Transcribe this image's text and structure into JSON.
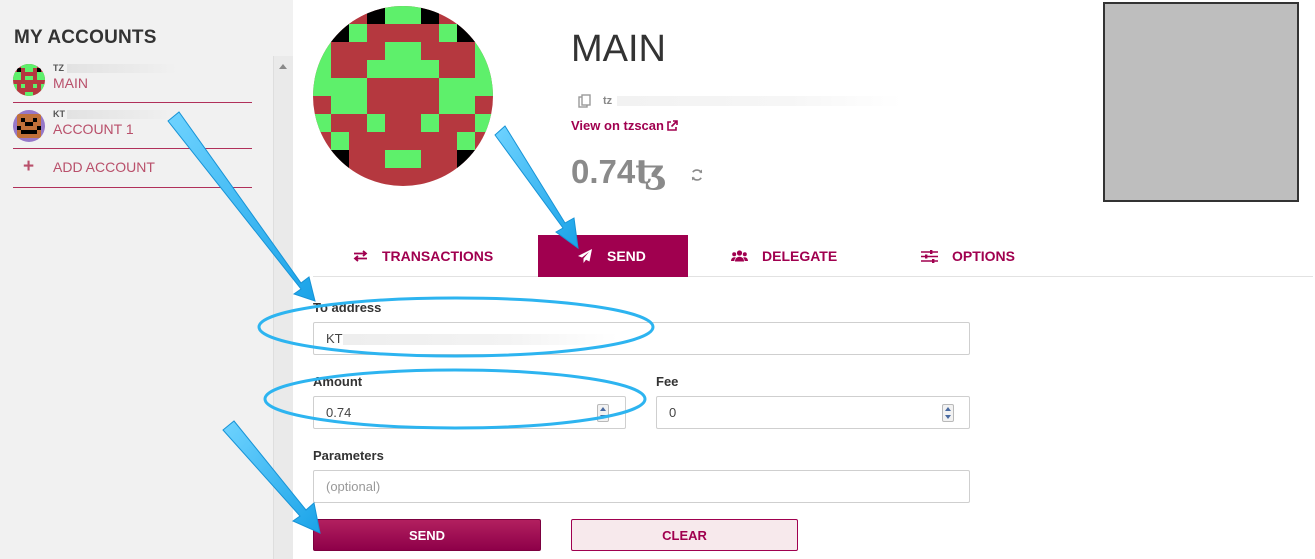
{
  "sidebar": {
    "title": "MY ACCOUNTS",
    "accounts": [
      {
        "address_prefix": "TZ",
        "name": "MAIN"
      },
      {
        "address_prefix": "KT",
        "name": "ACCOUNT 1"
      }
    ],
    "add_account_label": "ADD ACCOUNT"
  },
  "header": {
    "title": "MAIN",
    "address_prefix": "tz",
    "tzscan_link": "View on tzscan",
    "balance": "0.74",
    "currency_symbol": "ꜩ"
  },
  "tabs": [
    {
      "label": "TRANSACTIONS",
      "icon": "exchange-icon"
    },
    {
      "label": "SEND",
      "icon": "paper-plane-icon",
      "active": true
    },
    {
      "label": "DELEGATE",
      "icon": "users-icon"
    },
    {
      "label": "OPTIONS",
      "icon": "sliders-icon"
    }
  ],
  "form": {
    "to_address_label": "To address",
    "to_address_value": "KT",
    "amount_label": "Amount",
    "amount_value": "0.74",
    "fee_label": "Fee",
    "fee_value": "0",
    "parameters_label": "Parameters",
    "parameters_placeholder": "(optional)",
    "send_label": "SEND",
    "clear_label": "CLEAR"
  },
  "colors": {
    "accent": "#a0004f",
    "sidebar_bg": "#f1f1f1",
    "annotation": "#2db4f0",
    "identicon_red": "#b5383f",
    "identicon_green": "#5ef06b"
  }
}
